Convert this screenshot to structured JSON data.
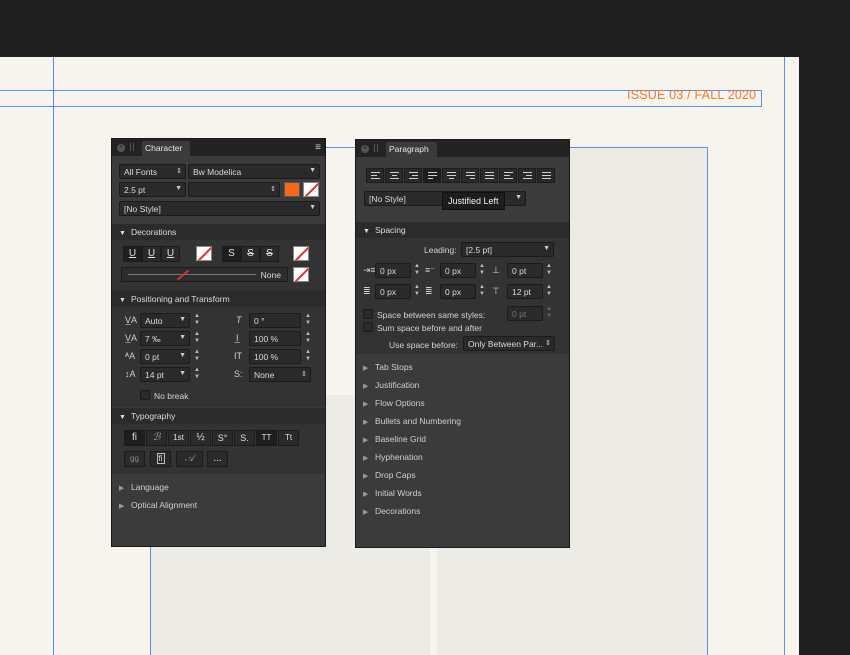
{
  "canvas": {
    "issue_text": "ISSUE 03 / FALL 2020",
    "accent_color": "#f07a30",
    "guide_color": "#5b8cf0"
  },
  "character_panel": {
    "tab_title": "Character",
    "font_collection": "All Fonts",
    "font_family": "Bw Modelica",
    "font_size": "2.5 pt",
    "font_style": "",
    "text_color": "#f36a1a",
    "style": "[No Style]",
    "decorations": {
      "title": "Decorations",
      "underline_buttons": [
        "U",
        "U",
        "U"
      ],
      "strike_buttons": [
        "S",
        "S",
        "S"
      ],
      "line_value": "None"
    },
    "positioning": {
      "title": "Positioning and Transform",
      "kerning": "Auto",
      "tracking": "7 ‰",
      "baseline": "0 pt",
      "leading": "14 pt",
      "shear": "0 °",
      "scale_vertical": "100 %",
      "scale_horizontal": "100 %",
      "justify": "None",
      "no_break_label": "No break"
    },
    "typography": {
      "title": "Typography",
      "row1": [
        "fi",
        "ℬ",
        "1st",
        "½",
        "S°",
        "S.",
        "TT",
        "Tt"
      ],
      "row2": [
        "gg",
        "fi",
        "𝒜",
        "..."
      ]
    },
    "collapsed": [
      "Language",
      "Optical Alignment"
    ]
  },
  "paragraph_panel": {
    "tab_title": "Paragraph",
    "style": "[No Style]",
    "tooltip": "Justified Left",
    "spacing": {
      "title": "Spacing",
      "leading_label": "Leading:",
      "leading_value": "[2.5 pt]",
      "left_indent": "0 px",
      "first_indent": "0 px",
      "space_before": "0 pt",
      "right_indent": "0 px",
      "last_indent": "0 px",
      "space_after": "12 pt",
      "same_styles_label": "Space between same styles:",
      "same_styles_value": "0 pt",
      "sum_label": "Sum space before and after",
      "use_before_label": "Use space before:",
      "use_before_value": "Only Between Par..."
    },
    "collapsed": [
      "Tab Stops",
      "Justification",
      "Flow Options",
      "Bullets and Numbering",
      "Baseline Grid",
      "Hyphenation",
      "Drop Caps",
      "Initial Words",
      "Decorations"
    ]
  }
}
